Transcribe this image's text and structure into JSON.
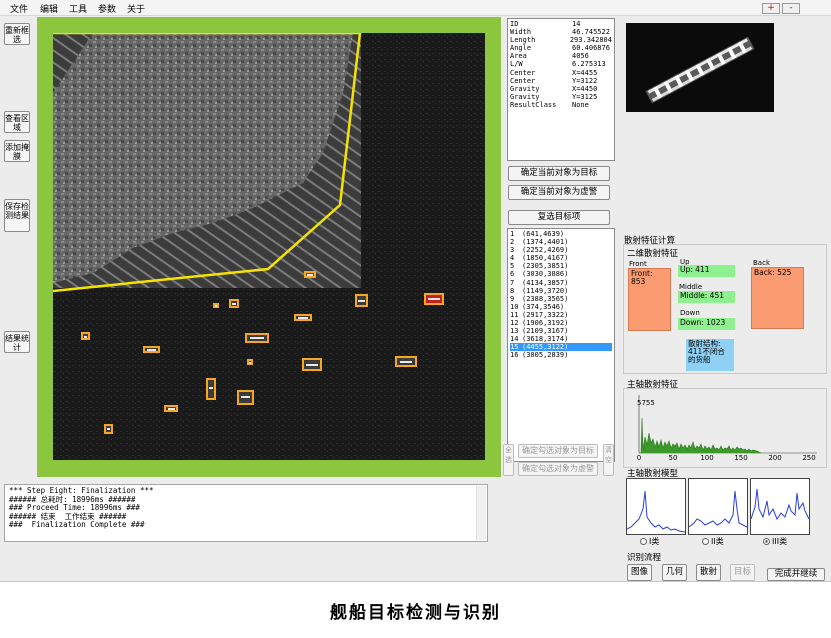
{
  "menu": {
    "items": [
      "文件",
      "编辑",
      "工具",
      "参数",
      "关于"
    ]
  },
  "window_controls": {
    "plus": "+",
    "minus": "-"
  },
  "left_buttons": {
    "reselect": "重新框选",
    "view_region": "查看区域",
    "add_mask": "添加掩膜",
    "save_result": "保存检测结果",
    "stats": "结果统计"
  },
  "target_info": {
    "rows": [
      {
        "key": "ID",
        "value": "14"
      },
      {
        "key": "Width",
        "value": "46.745522"
      },
      {
        "key": "Length",
        "value": "293.342804"
      },
      {
        "key": "Angle",
        "value": "60.406876"
      },
      {
        "key": "Area",
        "value": "4056"
      },
      {
        "key": "L/W",
        "value": "6.275313"
      },
      {
        "key": "Center",
        "value": "X=4455"
      },
      {
        "key": "Center",
        "value": "Y=3122"
      },
      {
        "key": "Gravity",
        "value": "X=4450"
      },
      {
        "key": "Gravity",
        "value": "Y=3125"
      },
      {
        "key": "ResultClass",
        "value": "None"
      }
    ]
  },
  "action_buttons": {
    "set_target": "确定当前对象为目标",
    "set_false": "确定当前对象为虚警",
    "reselect_targets": "复选目标项"
  },
  "target_list": {
    "selected_index": 14,
    "items": [
      {
        "n": "1",
        "coords": "(641,4639)"
      },
      {
        "n": "2",
        "coords": "(1374,4401)"
      },
      {
        "n": "3",
        "coords": "(2252,4269)"
      },
      {
        "n": "4",
        "coords": "(1850,4167)"
      },
      {
        "n": "5",
        "coords": "(2305,3851)"
      },
      {
        "n": "6",
        "coords": "(3030,3886)"
      },
      {
        "n": "7",
        "coords": "(4134,3857)"
      },
      {
        "n": "8",
        "coords": "(1149,3720)"
      },
      {
        "n": "9",
        "coords": "(2388,3565)"
      },
      {
        "n": "10",
        "coords": "(374,3546)"
      },
      {
        "n": "11",
        "coords": "(2917,3322)"
      },
      {
        "n": "12",
        "coords": "(1906,3192)"
      },
      {
        "n": "13",
        "coords": "(2109,3167)"
      },
      {
        "n": "14",
        "coords": "(3618,3174)"
      },
      {
        "n": "15",
        "coords": "(4455,3122)"
      },
      {
        "n": "16",
        "coords": "(3005,2839)"
      }
    ]
  },
  "disabled_buttons": {
    "mark_checked_target": "确定勾选对象为目标",
    "mark_checked_false": "确定勾选对象为虚警",
    "all": "全选",
    "clear": "清空"
  },
  "log": {
    "lines": [
      "*** Step Eight: Finalization ***",
      "###### 总耗时: 18996ms ######",
      "### Proceed Time: 18996ms ###",
      "###### 结束  工作结束 ######",
      "###  Finalization Complete ###"
    ]
  },
  "scatter": {
    "section_title": "散射特征计算",
    "sub_title": "二维散射特征",
    "front_header": "Front",
    "front_value": "Front: 853",
    "up_header": "Up",
    "up_value": "Up: 411",
    "middle_header": "Middle",
    "middle_value": "Middle: 451",
    "down_header": "Down",
    "down_value": "Down: 1023",
    "back_header": "Back",
    "back_value": "Back: 525",
    "structure_note": "散射结构: 411不闭合的货船"
  },
  "histogram": {
    "title": "主轴散射特征",
    "peak_label": "5755",
    "x_ticks": [
      "0",
      "50",
      "100",
      "150",
      "200",
      "250"
    ]
  },
  "model": {
    "title": "主轴散射模型",
    "options": [
      "I类",
      "II类",
      "III类"
    ],
    "selected": "III类"
  },
  "flow": {
    "title": "识别流程",
    "buttons": [
      "图像",
      "几何",
      "散射",
      "目标"
    ],
    "finish": "完成并继续"
  },
  "caption": "舰船目标检测与识别",
  "colors": {
    "frame": "#8cc63f",
    "box": "#f5a623",
    "selection": "#3399ff",
    "histogram": "#2d7a1e",
    "model_line": "#2a3fd6"
  }
}
